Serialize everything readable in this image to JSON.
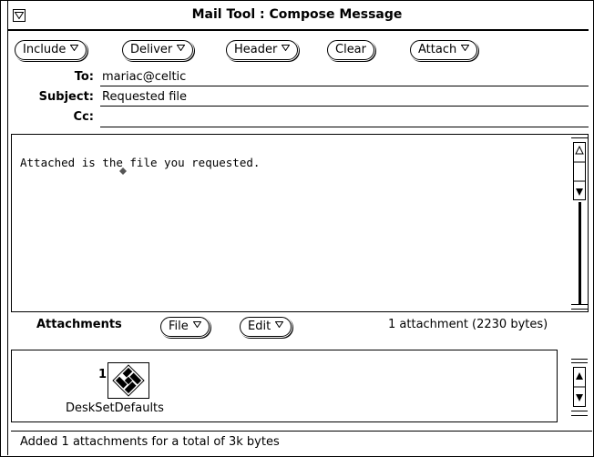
{
  "window": {
    "title": "Mail Tool : Compose Message"
  },
  "toolbar": {
    "buttons": [
      {
        "label": "Include",
        "menu": true
      },
      {
        "label": "Deliver",
        "menu": true
      },
      {
        "label": "Header",
        "menu": true
      },
      {
        "label": "Clear",
        "menu": false
      },
      {
        "label": "Attach",
        "menu": true
      }
    ]
  },
  "header": {
    "to_label": "To:",
    "to_value": "mariac@celtic",
    "subject_label": "Subject:",
    "subject_value": "Requested file",
    "cc_label": "Cc:",
    "cc_value": ""
  },
  "body": {
    "text": "Attached is the file you requested."
  },
  "attachments": {
    "label": "Attachments",
    "file_button": "File",
    "edit_button": "Edit",
    "count_text": "1 attachment (2230 bytes)",
    "items": [
      {
        "index": "1:",
        "name": "DeskSetDefaults",
        "icon": "deskset-defaults-icon"
      }
    ]
  },
  "footer": {
    "status": "Added 1 attachments for a total of 3k bytes"
  },
  "icons": {
    "window_menu": "window-menu-icon",
    "menu_triangle": "menu-triangle-icon",
    "scroll_up": "scroll-up-icon",
    "scroll_down": "scroll-down-icon"
  }
}
